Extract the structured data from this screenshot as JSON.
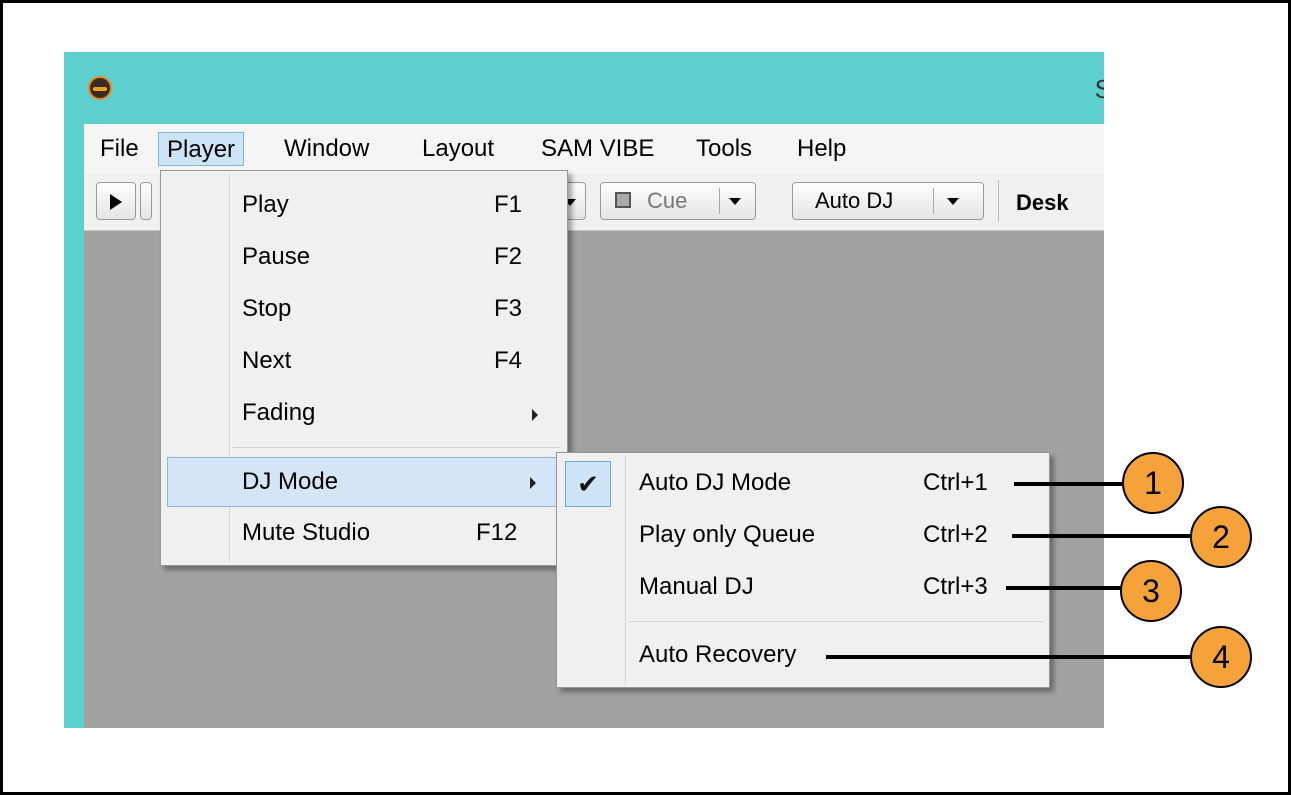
{
  "app": {
    "title": "S",
    "menubar": [
      "File",
      "Player",
      "Window",
      "Layout",
      "SAM VIBE",
      "Tools",
      "Help"
    ],
    "toolbar": {
      "cue_label": "Cue",
      "autodj_label": "Auto DJ",
      "desk_label": "Desk"
    }
  },
  "player_menu": {
    "items": [
      {
        "label": "Play",
        "shortcut": "F1"
      },
      {
        "label": "Pause",
        "shortcut": "F2"
      },
      {
        "label": "Stop",
        "shortcut": "F3"
      },
      {
        "label": "Next",
        "shortcut": "F4"
      },
      {
        "label": "Fading",
        "shortcut": ""
      },
      {
        "label": "DJ Mode",
        "shortcut": ""
      },
      {
        "label": "Mute Studio",
        "shortcut": "F12"
      }
    ]
  },
  "dj_mode_menu": {
    "items": [
      {
        "label": "Auto DJ Mode",
        "shortcut": "Ctrl+1",
        "checked": true
      },
      {
        "label": "Play only Queue",
        "shortcut": "Ctrl+2"
      },
      {
        "label": "Manual DJ",
        "shortcut": "Ctrl+3"
      },
      {
        "label": "Auto Recovery",
        "shortcut": ""
      }
    ]
  },
  "callouts": [
    "1",
    "2",
    "3",
    "4"
  ],
  "colors": {
    "title_bar": "#5ecfcf",
    "highlight": "#d3e5f6",
    "callout_fill": "#f6a23a",
    "workspace": "#a2a2a2"
  }
}
